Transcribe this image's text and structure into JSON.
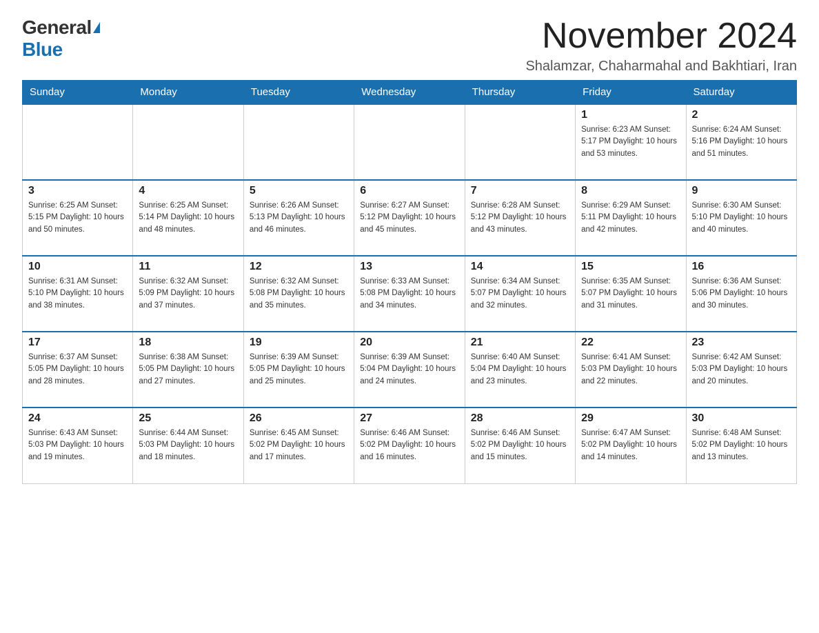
{
  "header": {
    "logo_general": "General",
    "logo_blue": "Blue",
    "month_title": "November 2024",
    "location": "Shalamzar, Chaharmahal and Bakhtiari, Iran"
  },
  "weekdays": [
    "Sunday",
    "Monday",
    "Tuesday",
    "Wednesday",
    "Thursday",
    "Friday",
    "Saturday"
  ],
  "weeks": [
    [
      {
        "day": "",
        "info": ""
      },
      {
        "day": "",
        "info": ""
      },
      {
        "day": "",
        "info": ""
      },
      {
        "day": "",
        "info": ""
      },
      {
        "day": "",
        "info": ""
      },
      {
        "day": "1",
        "info": "Sunrise: 6:23 AM\nSunset: 5:17 PM\nDaylight: 10 hours and 53 minutes."
      },
      {
        "day": "2",
        "info": "Sunrise: 6:24 AM\nSunset: 5:16 PM\nDaylight: 10 hours and 51 minutes."
      }
    ],
    [
      {
        "day": "3",
        "info": "Sunrise: 6:25 AM\nSunset: 5:15 PM\nDaylight: 10 hours and 50 minutes."
      },
      {
        "day": "4",
        "info": "Sunrise: 6:25 AM\nSunset: 5:14 PM\nDaylight: 10 hours and 48 minutes."
      },
      {
        "day": "5",
        "info": "Sunrise: 6:26 AM\nSunset: 5:13 PM\nDaylight: 10 hours and 46 minutes."
      },
      {
        "day": "6",
        "info": "Sunrise: 6:27 AM\nSunset: 5:12 PM\nDaylight: 10 hours and 45 minutes."
      },
      {
        "day": "7",
        "info": "Sunrise: 6:28 AM\nSunset: 5:12 PM\nDaylight: 10 hours and 43 minutes."
      },
      {
        "day": "8",
        "info": "Sunrise: 6:29 AM\nSunset: 5:11 PM\nDaylight: 10 hours and 42 minutes."
      },
      {
        "day": "9",
        "info": "Sunrise: 6:30 AM\nSunset: 5:10 PM\nDaylight: 10 hours and 40 minutes."
      }
    ],
    [
      {
        "day": "10",
        "info": "Sunrise: 6:31 AM\nSunset: 5:10 PM\nDaylight: 10 hours and 38 minutes."
      },
      {
        "day": "11",
        "info": "Sunrise: 6:32 AM\nSunset: 5:09 PM\nDaylight: 10 hours and 37 minutes."
      },
      {
        "day": "12",
        "info": "Sunrise: 6:32 AM\nSunset: 5:08 PM\nDaylight: 10 hours and 35 minutes."
      },
      {
        "day": "13",
        "info": "Sunrise: 6:33 AM\nSunset: 5:08 PM\nDaylight: 10 hours and 34 minutes."
      },
      {
        "day": "14",
        "info": "Sunrise: 6:34 AM\nSunset: 5:07 PM\nDaylight: 10 hours and 32 minutes."
      },
      {
        "day": "15",
        "info": "Sunrise: 6:35 AM\nSunset: 5:07 PM\nDaylight: 10 hours and 31 minutes."
      },
      {
        "day": "16",
        "info": "Sunrise: 6:36 AM\nSunset: 5:06 PM\nDaylight: 10 hours and 30 minutes."
      }
    ],
    [
      {
        "day": "17",
        "info": "Sunrise: 6:37 AM\nSunset: 5:05 PM\nDaylight: 10 hours and 28 minutes."
      },
      {
        "day": "18",
        "info": "Sunrise: 6:38 AM\nSunset: 5:05 PM\nDaylight: 10 hours and 27 minutes."
      },
      {
        "day": "19",
        "info": "Sunrise: 6:39 AM\nSunset: 5:05 PM\nDaylight: 10 hours and 25 minutes."
      },
      {
        "day": "20",
        "info": "Sunrise: 6:39 AM\nSunset: 5:04 PM\nDaylight: 10 hours and 24 minutes."
      },
      {
        "day": "21",
        "info": "Sunrise: 6:40 AM\nSunset: 5:04 PM\nDaylight: 10 hours and 23 minutes."
      },
      {
        "day": "22",
        "info": "Sunrise: 6:41 AM\nSunset: 5:03 PM\nDaylight: 10 hours and 22 minutes."
      },
      {
        "day": "23",
        "info": "Sunrise: 6:42 AM\nSunset: 5:03 PM\nDaylight: 10 hours and 20 minutes."
      }
    ],
    [
      {
        "day": "24",
        "info": "Sunrise: 6:43 AM\nSunset: 5:03 PM\nDaylight: 10 hours and 19 minutes."
      },
      {
        "day": "25",
        "info": "Sunrise: 6:44 AM\nSunset: 5:03 PM\nDaylight: 10 hours and 18 minutes."
      },
      {
        "day": "26",
        "info": "Sunrise: 6:45 AM\nSunset: 5:02 PM\nDaylight: 10 hours and 17 minutes."
      },
      {
        "day": "27",
        "info": "Sunrise: 6:46 AM\nSunset: 5:02 PM\nDaylight: 10 hours and 16 minutes."
      },
      {
        "day": "28",
        "info": "Sunrise: 6:46 AM\nSunset: 5:02 PM\nDaylight: 10 hours and 15 minutes."
      },
      {
        "day": "29",
        "info": "Sunrise: 6:47 AM\nSunset: 5:02 PM\nDaylight: 10 hours and 14 minutes."
      },
      {
        "day": "30",
        "info": "Sunrise: 6:48 AM\nSunset: 5:02 PM\nDaylight: 10 hours and 13 minutes."
      }
    ]
  ]
}
